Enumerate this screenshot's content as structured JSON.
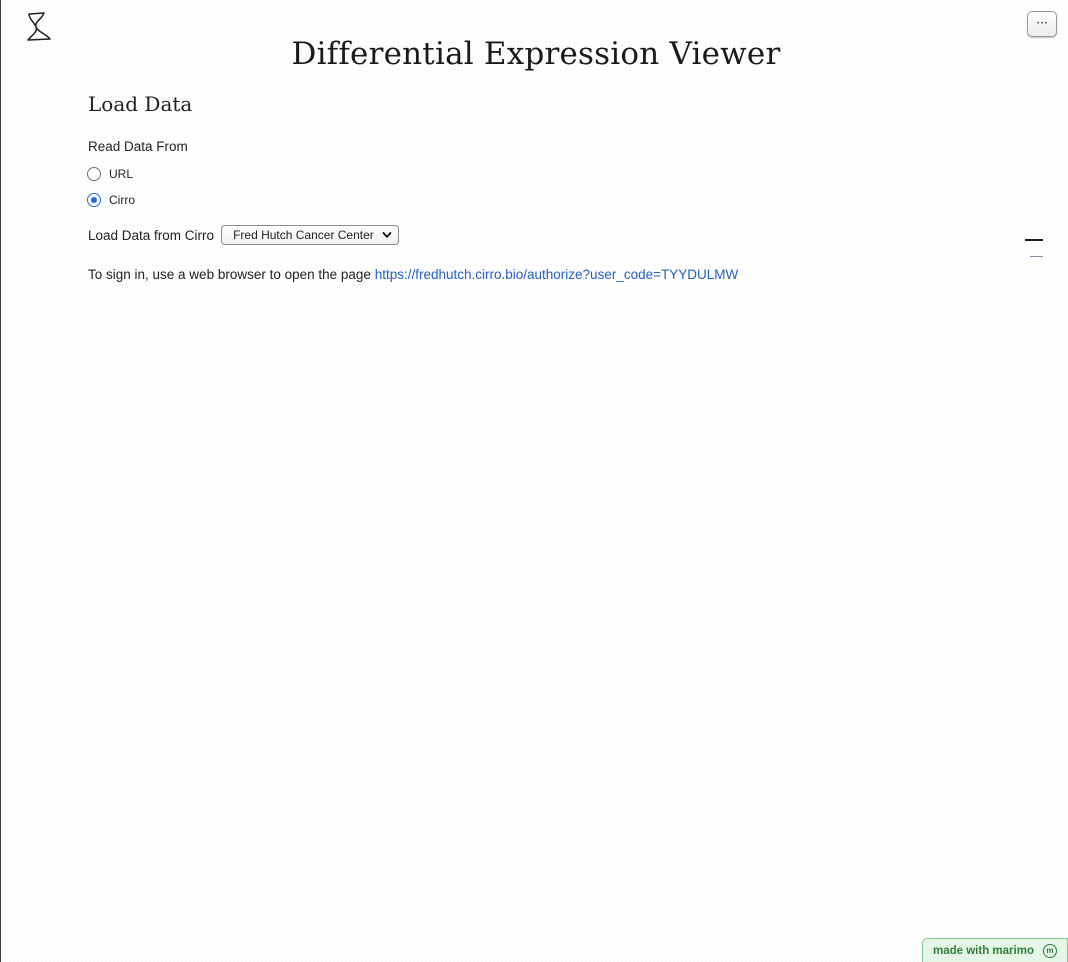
{
  "app": {
    "logo_icon": "hourglass-logo-icon",
    "menu_button_label": "···"
  },
  "header": {
    "title": "Differential Expression Viewer"
  },
  "load_section": {
    "heading": "Load Data",
    "source_label": "Read Data From",
    "options": [
      {
        "label": "URL",
        "checked": false
      },
      {
        "label": "Cirro",
        "checked": true
      }
    ],
    "select_label": "Load Data from Cirro",
    "select_value": "Fred Hutch Cancer Center",
    "signin_text": "To sign in, use a web browser to open the page ",
    "signin_link": "https://fredhutch.cirro.bio/authorize?user_code=TYYDULMW"
  },
  "footer": {
    "badge_label": "made with marimo",
    "badge_icon_glyph": "m"
  },
  "colors": {
    "accent": "#2867d6",
    "link": "#2460c2",
    "badge_bg": "#e5f6e6",
    "badge_text": "#2f7d3c"
  }
}
